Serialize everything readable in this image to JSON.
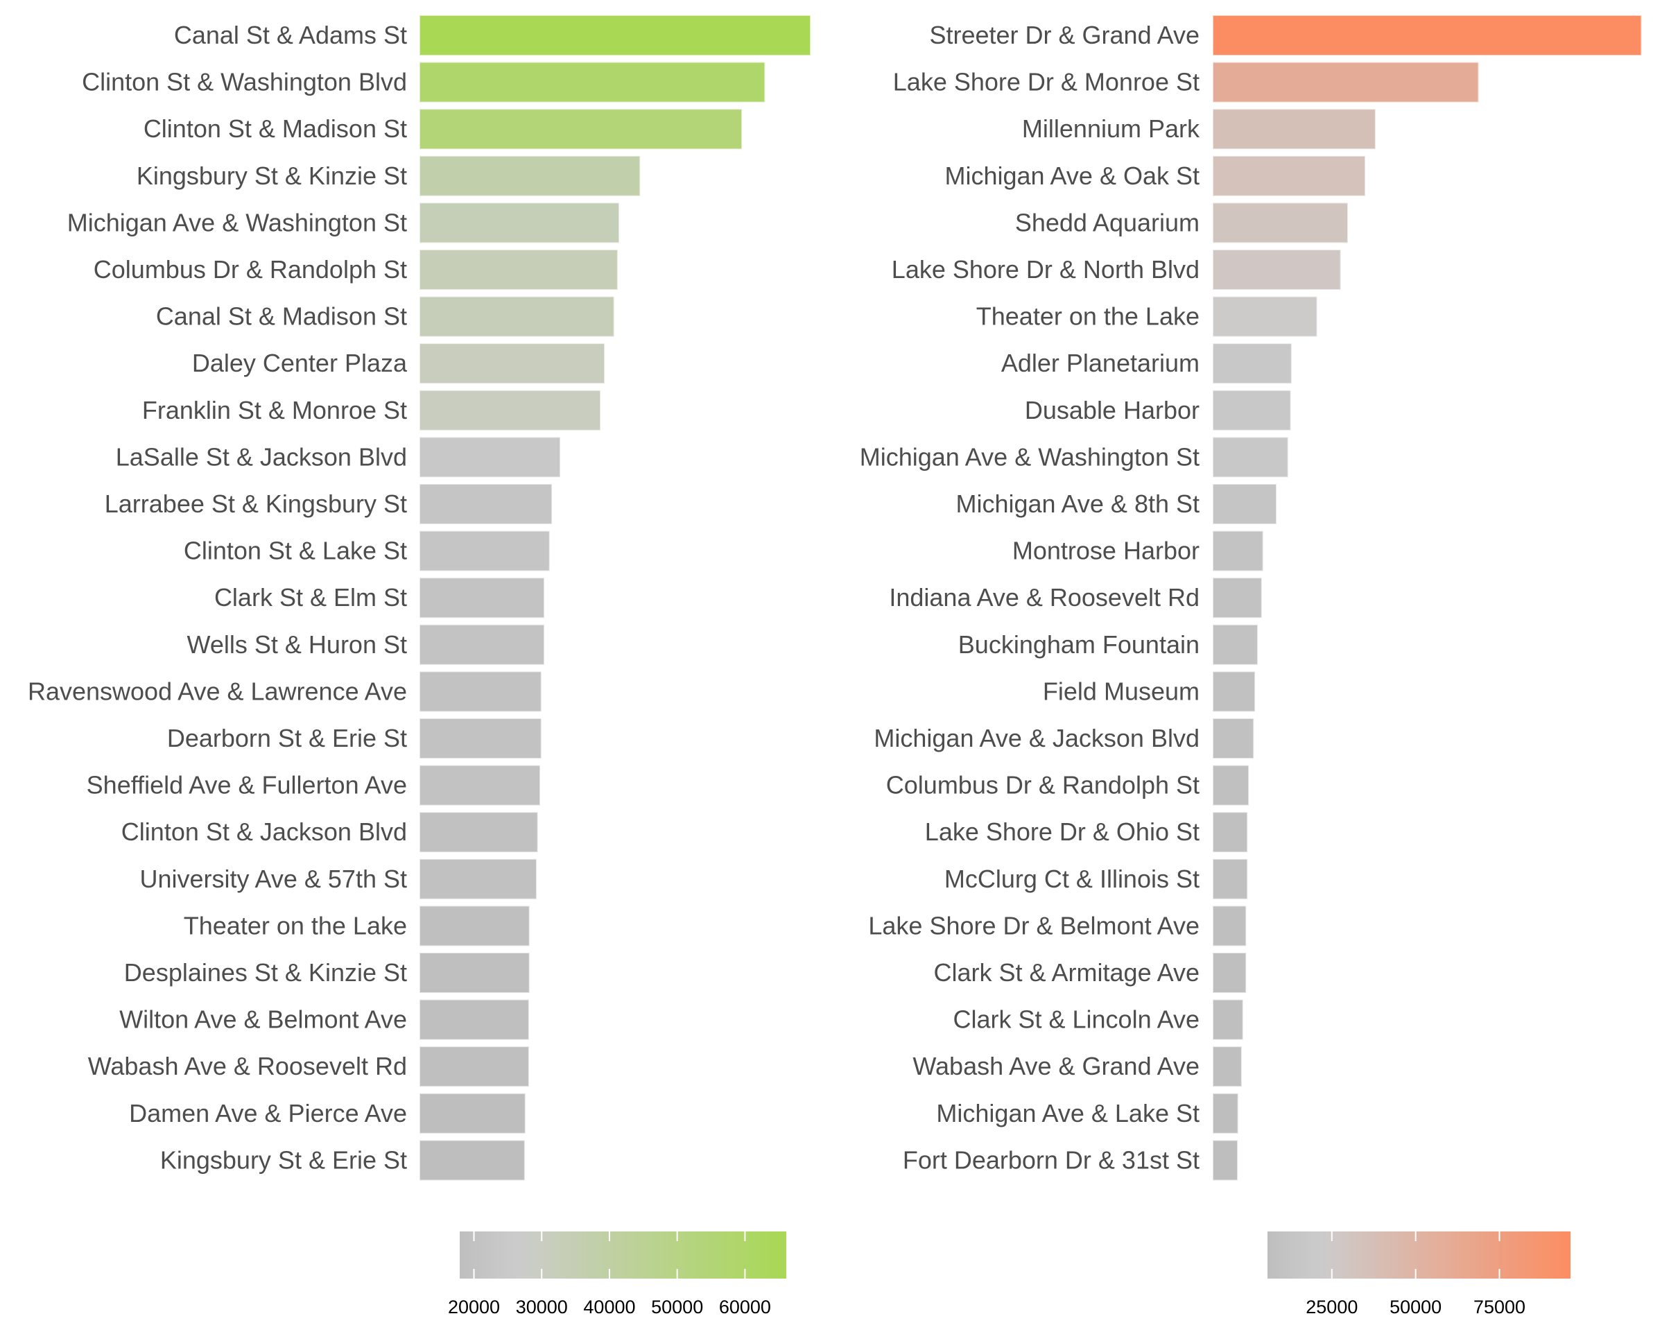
{
  "chart_data": [
    {
      "type": "bar",
      "orientation": "horizontal",
      "title": "",
      "xlabel": "",
      "ylabel": "",
      "grid": false,
      "legend": {
        "type": "colorbar",
        "placement": "bottom",
        "ticks": [
          20000,
          30000,
          40000,
          50000,
          60000
        ],
        "tick_labels": [
          "20000",
          "30000",
          "40000",
          "50000",
          "60000"
        ],
        "range": [
          17900,
          66100
        ]
      },
      "colors": {
        "low": "#bebebe",
        "mid": "#cccccc",
        "high": "#a8d854"
      },
      "categories": [
        "Canal St & Adams St",
        "Clinton St & Washington Blvd",
        "Clinton St & Madison St",
        "Kingsbury St & Kinzie St",
        "Michigan Ave & Washington St",
        "Columbus Dr & Randolph St",
        "Canal St & Madison St",
        "Daley Center Plaza",
        "Franklin St & Monroe St",
        "LaSalle St & Jackson Blvd",
        "Larrabee St & Kingsbury St",
        "Clinton St & Lake St",
        "Clark St & Elm St",
        "Wells St & Huron St",
        "Ravenswood Ave & Lawrence Ave",
        "Dearborn St & Erie St",
        "Sheffield Ave & Fullerton Ave",
        "Clinton St & Jackson Blvd",
        "University Ave & 57th St",
        "Theater on the Lake",
        "Desplaines St & Kinzie St",
        "Wilton Ave & Belmont Ave",
        "Wabash Ave & Roosevelt Rd",
        "Damen Ave & Pierce Ave",
        "Kingsbury St & Erie St"
      ],
      "values": [
        66100,
        58400,
        54500,
        37300,
        33750,
        33500,
        32900,
        31300,
        30600,
        23800,
        22400,
        22000,
        21100,
        21100,
        20600,
        20600,
        20400,
        20000,
        19800,
        18600,
        18600,
        18500,
        18500,
        17900,
        17800
      ]
    },
    {
      "type": "bar",
      "orientation": "horizontal",
      "title": "",
      "xlabel": "",
      "ylabel": "",
      "grid": false,
      "legend": {
        "type": "colorbar",
        "placement": "bottom",
        "ticks": [
          25000,
          50000,
          75000
        ],
        "tick_labels": [
          "25000",
          "50000",
          "75000"
        ],
        "range": [
          5800,
          96200
        ]
      },
      "colors": {
        "low": "#bebebe",
        "mid": "#cccccc",
        "high": "#fc8d62"
      },
      "categories": [
        "Streeter Dr & Grand Ave",
        "Lake Shore Dr & Monroe St",
        "Millennium Park",
        "Michigan Ave & Oak St",
        "Shedd Aquarium",
        "Lake Shore Dr & North Blvd",
        "Theater on the Lake",
        "Adler Planetarium",
        "Dusable Harbor",
        "Michigan Ave & Washington St",
        "Michigan Ave & 8th St",
        "Montrose Harbor",
        "Indiana Ave & Roosevelt Rd",
        "Buckingham Fountain",
        "Field Museum",
        "Michigan Ave & Jackson Blvd",
        "Columbus Dr & Randolph St",
        "Lake Shore Dr & Ohio St",
        "McClurg Ct & Illinois St",
        "Lake Shore Dr & Belmont Ave",
        "Clark St & Armitage Ave",
        "Clark St & Lincoln Ave",
        "Wabash Ave & Grand Ave",
        "Michigan Ave & Lake St",
        "Fort Dearborn Dr & 31st St"
      ],
      "values": [
        96100,
        59600,
        36500,
        34200,
        30300,
        28700,
        23400,
        17700,
        17500,
        16900,
        14300,
        11300,
        11000,
        10100,
        9500,
        9200,
        8100,
        7800,
        7800,
        7500,
        7500,
        6800,
        6500,
        5700,
        5600
      ]
    }
  ]
}
